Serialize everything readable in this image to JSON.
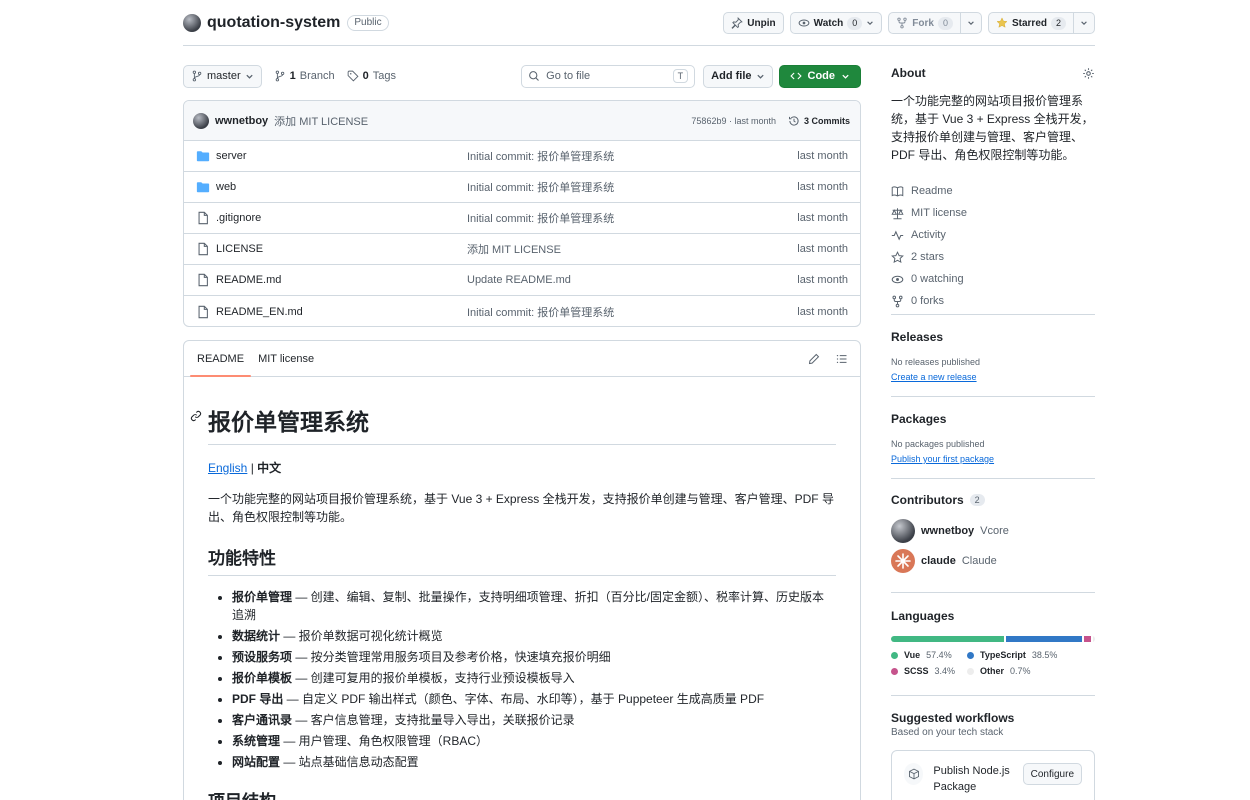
{
  "repo": {
    "name": "quotation-system",
    "visibility": "Public"
  },
  "header_actions": {
    "unpin": "Unpin",
    "watch": "Watch",
    "watch_count": "0",
    "fork": "Fork",
    "fork_count": "0",
    "starred": "Starred",
    "star_count": "2"
  },
  "toolbar": {
    "branch": "master",
    "branch_count": "1",
    "branch_label": "Branch",
    "tag_count": "0",
    "tag_label": "Tags",
    "goto_placeholder": "Go to file",
    "goto_kbd": "T",
    "add_file": "Add file",
    "code": "Code"
  },
  "last_commit": {
    "author": "wwnetboy",
    "message": "添加 MIT LICENSE",
    "hash_time": "75862b9 · last month",
    "commits": "3 Commits"
  },
  "files": [
    {
      "name": "server",
      "type": "dir",
      "commit": "Initial commit: 报价单管理系统",
      "time": "last month"
    },
    {
      "name": "web",
      "type": "dir",
      "commit": "Initial commit: 报价单管理系统",
      "time": "last month"
    },
    {
      "name": ".gitignore",
      "type": "file",
      "commit": "Initial commit: 报价单管理系统",
      "time": "last month"
    },
    {
      "name": "LICENSE",
      "type": "file",
      "commit": "添加 MIT LICENSE",
      "time": "last month"
    },
    {
      "name": "README.md",
      "type": "file",
      "commit": "Update README.md",
      "time": "last month"
    },
    {
      "name": "README_EN.md",
      "type": "file",
      "commit": "Initial commit: 报价单管理系统",
      "time": "last month"
    }
  ],
  "readme": {
    "tabs": [
      "README",
      "MIT license"
    ],
    "title": "报价单管理系统",
    "lang_en": "English",
    "lang_sep": " | ",
    "lang_zh": "中文",
    "description": "一个功能完整的网站项目报价管理系统，基于 Vue 3 + Express 全栈开发，支持报价单创建与管理、客户管理、PDF 导出、角色权限控制等功能。",
    "features_heading": "功能特性",
    "features": [
      {
        "name": "报价单管理",
        "text": " — 创建、编辑、复制、批量操作，支持明细项管理、折扣（百分比/固定金额）、税率计算、历史版本追溯"
      },
      {
        "name": "数据统计",
        "text": " — 报价单数据可视化统计概览"
      },
      {
        "name": "预设服务项",
        "text": " — 按分类管理常用服务项目及参考价格，快速填充报价明细"
      },
      {
        "name": "报价单模板",
        "text": " — 创建可复用的报价单模板，支持行业预设模板导入"
      },
      {
        "name": "PDF 导出",
        "text": " — 自定义 PDF 输出样式（颜色、字体、布局、水印等），基于 Puppeteer 生成高质量 PDF"
      },
      {
        "name": "客户通讯录",
        "text": " — 客户信息管理，支持批量导入导出，关联报价记录"
      },
      {
        "name": "系统管理",
        "text": " — 用户管理、角色权限管理（RBAC）"
      },
      {
        "name": "网站配置",
        "text": " — 站点基础信息动态配置"
      }
    ],
    "structure_heading": "项目结构"
  },
  "sidebar": {
    "about_heading": "About",
    "about_desc": "一个功能完整的网站项目报价管理系统，基于 Vue 3 + Express 全栈开发，支持报价单创建与管理、客户管理、PDF 导出、角色权限控制等功能。",
    "links": [
      {
        "icon": "book-icon",
        "label": "Readme"
      },
      {
        "icon": "law-icon",
        "label": "MIT license"
      },
      {
        "icon": "pulse-icon",
        "label": "Activity"
      },
      {
        "icon": "star-icon",
        "label": "2 stars"
      },
      {
        "icon": "eye-icon",
        "label": "0 watching"
      },
      {
        "icon": "fork-icon",
        "label": "0 forks"
      }
    ],
    "releases_heading": "Releases",
    "releases_none": "No releases published",
    "releases_create": "Create a new release",
    "packages_heading": "Packages",
    "packages_none": "No packages published",
    "packages_publish": "Publish your first package",
    "contributors_heading": "Contributors",
    "contributors_count": "2",
    "contributors": [
      {
        "login": "wwnetboy",
        "name": "Vcore"
      },
      {
        "login": "claude",
        "name": "Claude"
      }
    ],
    "languages_heading": "Languages",
    "languages": [
      {
        "name": "Vue",
        "percent": "57.4%",
        "value": 57.4,
        "color": "#41b883"
      },
      {
        "name": "TypeScript",
        "percent": "38.5%",
        "value": 38.5,
        "color": "#3178c6"
      },
      {
        "name": "SCSS",
        "percent": "3.4%",
        "value": 3.4,
        "color": "#c6538c"
      },
      {
        "name": "Other",
        "percent": "0.7%",
        "value": 0.7,
        "color": "#ededed"
      }
    ],
    "workflows_heading": "Suggested workflows",
    "workflows_sub": "Based on your tech stack",
    "workflow_title": "Publish Node.js Package",
    "workflow_configure": "Configure"
  }
}
